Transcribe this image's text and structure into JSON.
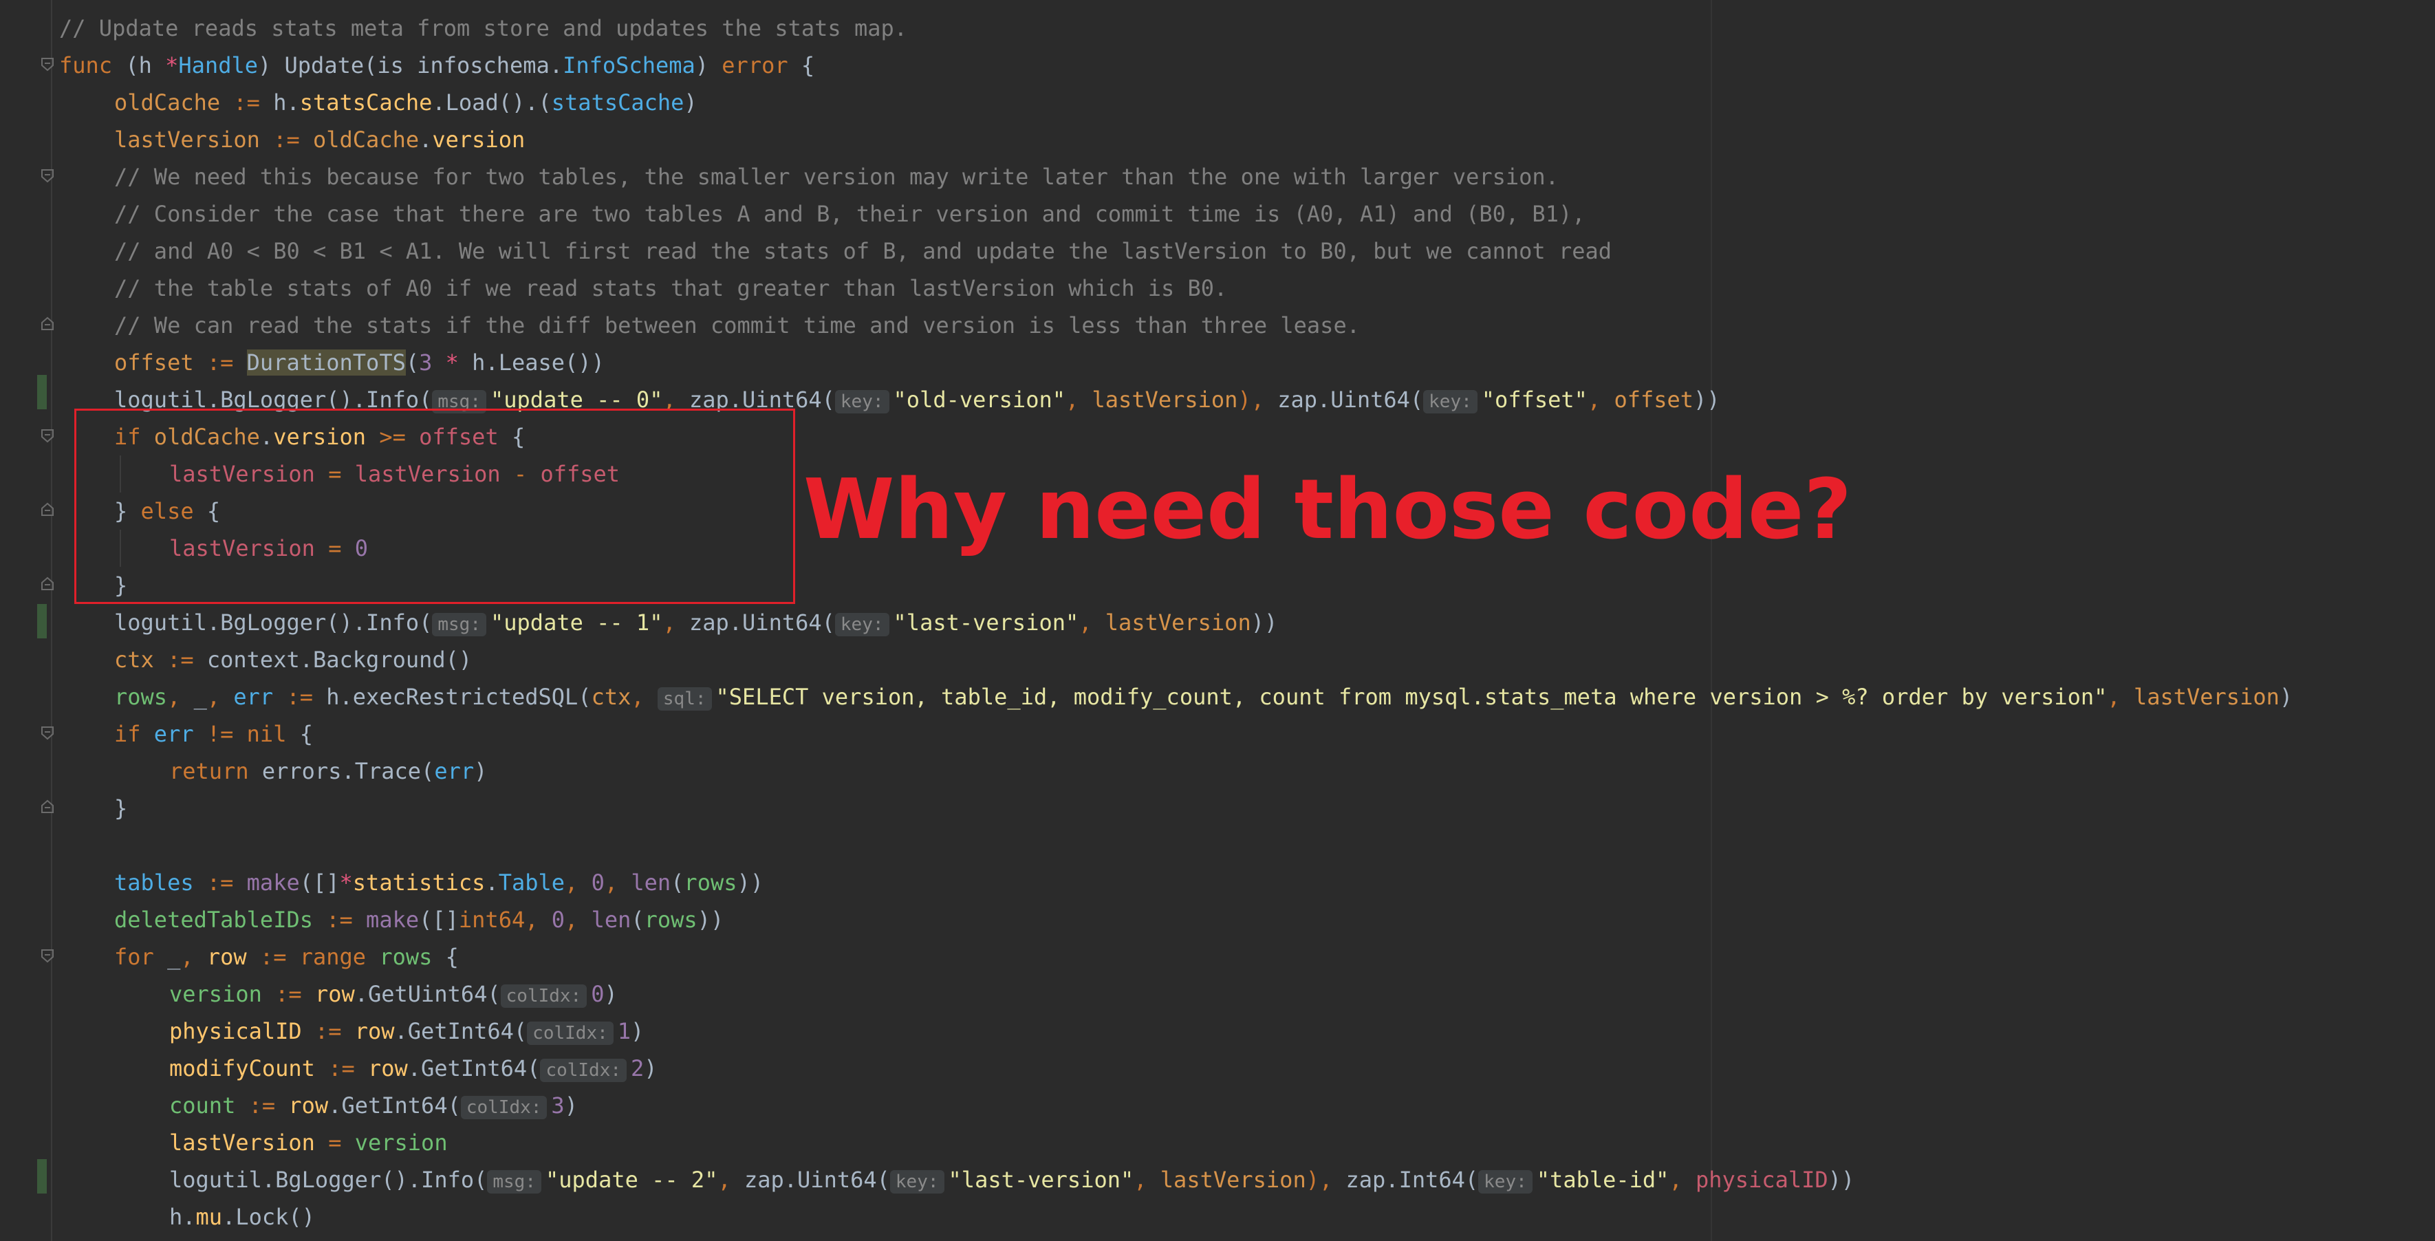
{
  "annotation": {
    "text": "Why need those code?",
    "color": "#e8202a"
  },
  "colors": {
    "background": "#2b2b2b",
    "keyword": "#cc7832",
    "comment": "#808080",
    "string": "#e7e6a3",
    "number": "#9876aa"
  },
  "code": {
    "c1": "// Update reads stats meta from store and updates the stats map.",
    "l2": [
      "func",
      " (",
      "h",
      " ",
      "*",
      "Handle",
      ") ",
      "Update",
      "(",
      "is",
      " ",
      "infoschema",
      ".",
      "InfoSchema",
      ") ",
      "error",
      " {"
    ],
    "l3": [
      "oldCache",
      " := ",
      "h",
      ".",
      "statsCache",
      ".",
      "Load",
      "().(",
      "statsCache",
      ")"
    ],
    "l4": [
      "lastVersion",
      " := ",
      "oldCache",
      ".",
      "version"
    ],
    "c5": "// We need this because for two tables, the smaller version may write later than the one with larger version.",
    "c6": "// Consider the case that there are two tables A and B, their version and commit time is (A0, A1) and (B0, B1),",
    "c7": "// and A0 < B0 < B1 < A1. We will first read the stats of B, and update the lastVersion to B0, but we cannot read",
    "c8": "// the table stats of A0 if we read stats that greater than lastVersion which is B0.",
    "c9": "// We can read the stats if the diff between commit time and version is less than three lease.",
    "l10": [
      "offset",
      " := ",
      "DurationToTS",
      "(",
      "3",
      " * ",
      "h",
      ".",
      "Lease",
      "())"
    ],
    "l11": [
      "logutil",
      ".",
      "BgLogger",
      "().",
      "Info",
      "(",
      "msg:",
      "\"update -- 0\"",
      ", ",
      "zap",
      ".",
      "Uint64",
      "(",
      "key:",
      "\"old-version\"",
      ", ",
      "lastVersion",
      "), ",
      "zap",
      ".",
      "Uint64",
      "(",
      "key:",
      "\"offset\"",
      ", ",
      "offset",
      "))"
    ],
    "l12": [
      "if",
      " ",
      "oldCache",
      ".",
      "version",
      " >= ",
      "offset",
      " {"
    ],
    "l13": [
      "lastVersion",
      " = ",
      "lastVersion",
      " - ",
      "offset"
    ],
    "l14": [
      "}",
      " else ",
      "{"
    ],
    "l15": [
      "lastVersion",
      " = ",
      "0"
    ],
    "l16": [
      "}"
    ],
    "l17": [
      "logutil",
      ".",
      "BgLogger",
      "().",
      "Info",
      "(",
      "msg:",
      "\"update -- 1\"",
      ", ",
      "zap",
      ".",
      "Uint64",
      "(",
      "key:",
      "\"last-version\"",
      ", ",
      "lastVersion",
      "))"
    ],
    "l18": [
      "ctx",
      " := ",
      "context",
      ".",
      "Background",
      "()"
    ],
    "l19": [
      "rows",
      ", ",
      "_",
      ", ",
      "err",
      " := ",
      "h",
      ".",
      "execRestrictedSQL",
      "(",
      "ctx",
      ", ",
      "sql:",
      "\"SELECT version, table_id, modify_count, count from mysql.stats_meta where version > %? order by version\"",
      ", ",
      "lastVersion",
      ")"
    ],
    "l20": [
      "if",
      " ",
      "err",
      " != ",
      "nil",
      " {"
    ],
    "l21": [
      "return",
      " ",
      "errors",
      ".",
      "Trace",
      "(",
      "err",
      ")"
    ],
    "l22": [
      "}"
    ],
    "l24": [
      "tables",
      " := ",
      "make",
      "([]",
      "*",
      "statistics",
      ".",
      "Table",
      ", ",
      "0",
      ", ",
      "len",
      "(",
      "rows",
      "))"
    ],
    "l25": [
      "deletedTableIDs",
      " := ",
      "make",
      "([]",
      "int64",
      ", ",
      "0",
      ", ",
      "len",
      "(",
      "rows",
      "))"
    ],
    "l26": [
      "for",
      " ",
      "_",
      ", ",
      "row",
      " := ",
      "range",
      " ",
      "rows",
      " {"
    ],
    "l27": [
      "version",
      " := ",
      "row",
      ".",
      "GetUint64",
      "(",
      "colIdx:",
      "0",
      ")"
    ],
    "l28": [
      "physicalID",
      " := ",
      "row",
      ".",
      "GetInt64",
      "(",
      "colIdx:",
      "1",
      ")"
    ],
    "l29": [
      "modifyCount",
      " := ",
      "row",
      ".",
      "GetInt64",
      "(",
      "colIdx:",
      "2",
      ")"
    ],
    "l30": [
      "count",
      " := ",
      "row",
      ".",
      "GetInt64",
      "(",
      "colIdx:",
      "3",
      ")"
    ],
    "l31": [
      "lastVersion",
      " = ",
      "version"
    ],
    "l32": [
      "logutil",
      ".",
      "BgLogger",
      "().",
      "Info",
      "(",
      "msg:",
      "\"update -- 2\"",
      ", ",
      "zap",
      ".",
      "Uint64",
      "(",
      "key:",
      "\"last-version\"",
      ", ",
      "lastVersion",
      "), ",
      "zap",
      ".",
      "Int64",
      "(",
      "key:",
      "\"table-id\"",
      ", ",
      "physicalID",
      "))"
    ],
    "l33": [
      "h",
      ".",
      "mu",
      ".",
      "Lock",
      "()"
    ]
  }
}
